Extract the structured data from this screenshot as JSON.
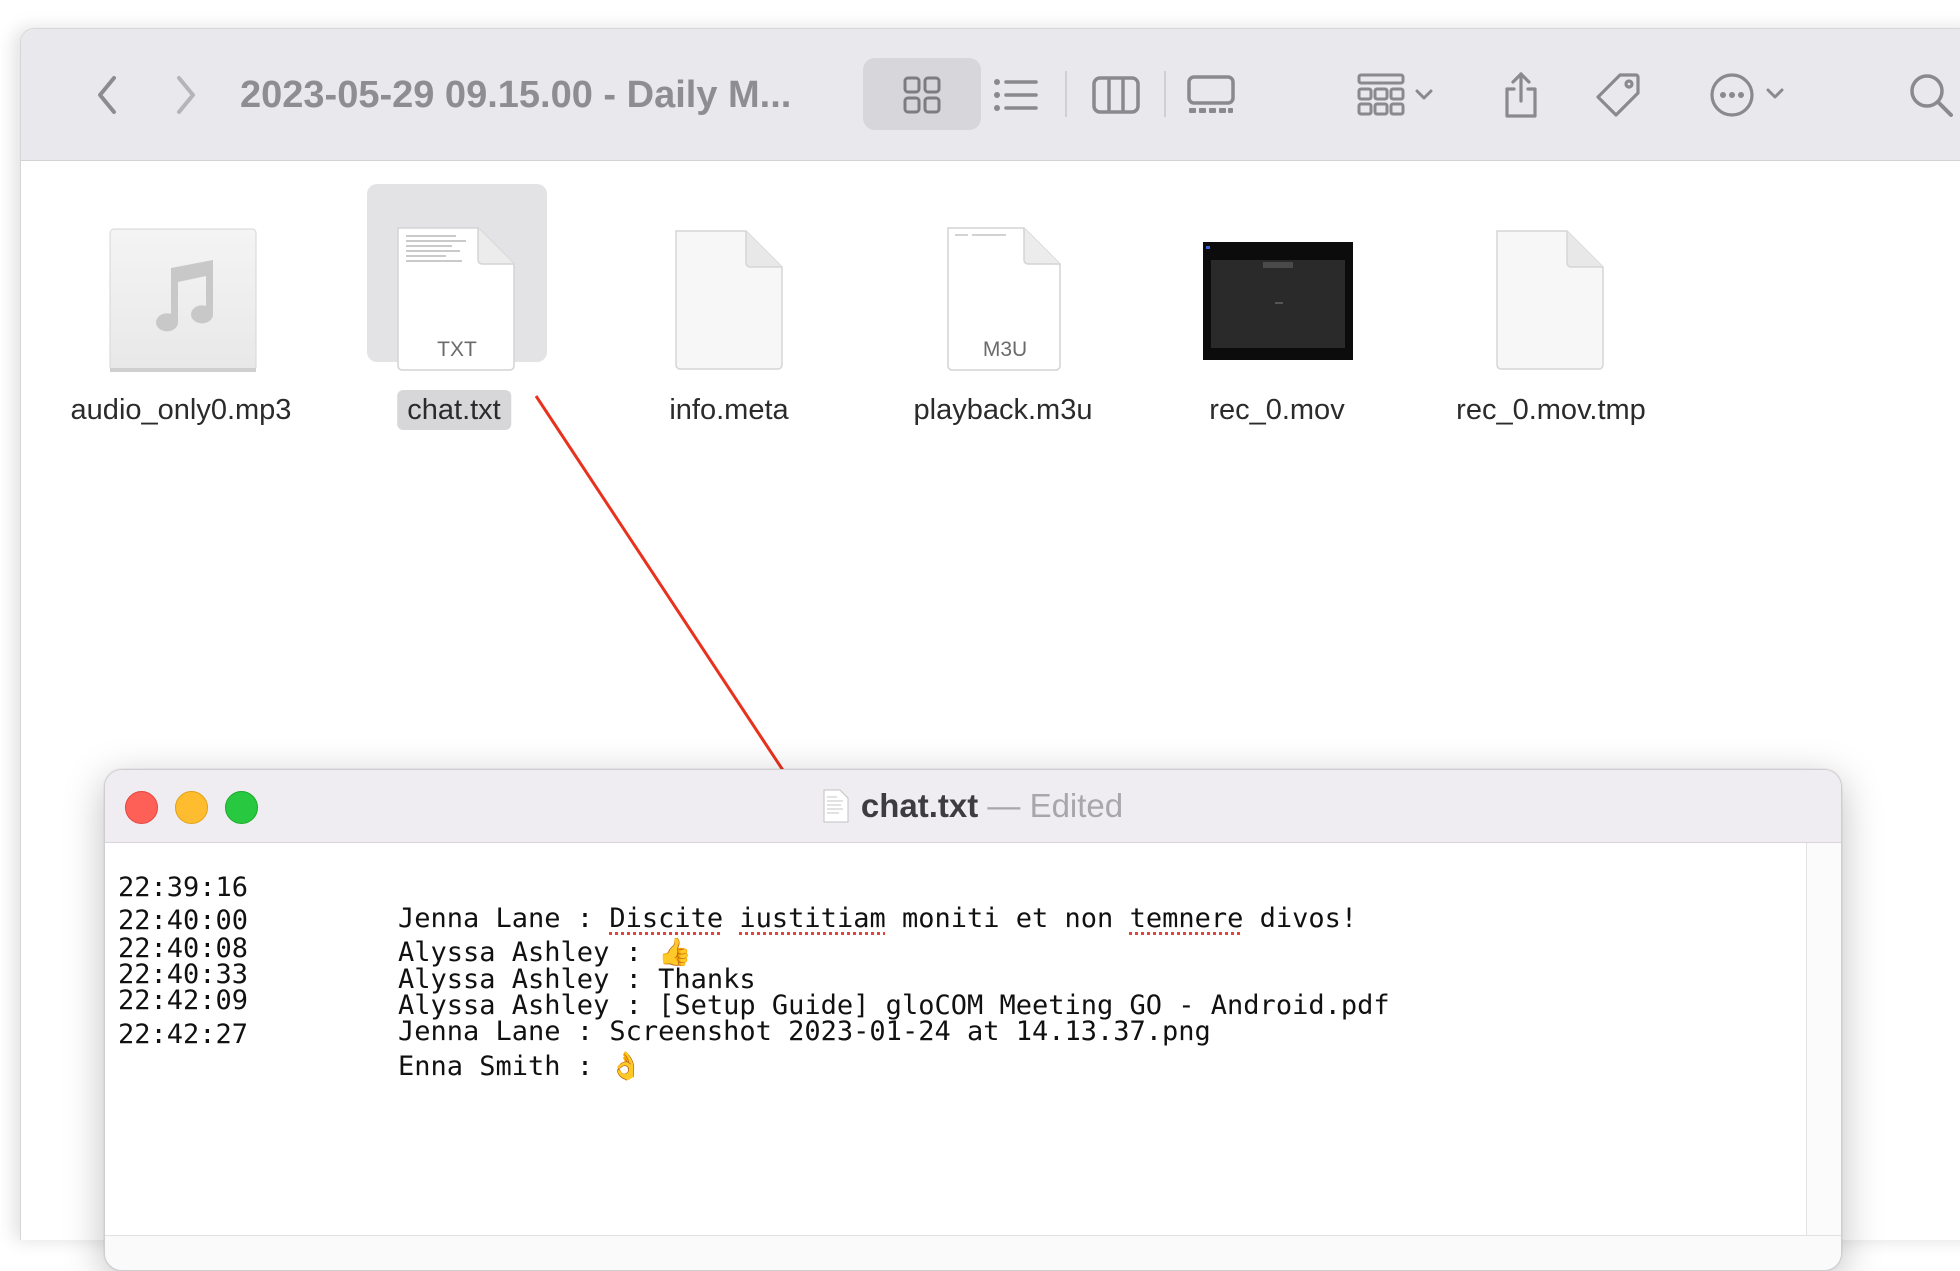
{
  "finder": {
    "title": "2023-05-29 09.15.00 - Daily M...",
    "files": [
      {
        "name": "audio_only0.mp3",
        "kind": "music"
      },
      {
        "name": "chat.txt",
        "kind": "txt",
        "badge": "TXT",
        "selected": true
      },
      {
        "name": "info.meta",
        "kind": "blank"
      },
      {
        "name": "playback.m3u",
        "kind": "m3u",
        "badge": "M3U"
      },
      {
        "name": "rec_0.mov",
        "kind": "video"
      },
      {
        "name": "rec_0.mov.tmp",
        "kind": "blank"
      }
    ]
  },
  "textedit": {
    "filename": "chat.txt",
    "separator": "—",
    "status": "Edited",
    "lines": [
      {
        "time": "22:39:16",
        "sender": "Jenna Lane",
        "message": "Discite iustitiam moniti et non temnere divos!"
      },
      {
        "time": "22:40:00",
        "sender": "Alyssa Ashley",
        "message": "👍"
      },
      {
        "time": "22:40:08",
        "sender": "Alyssa Ashley",
        "message": "Thanks"
      },
      {
        "time": "22:40:33",
        "sender": "Alyssa Ashley",
        "message": "[Setup Guide] gloCOM Meeting GO - Android.pdf"
      },
      {
        "time": "22:42:09",
        "sender": "Jenna Lane",
        "message": "Screenshot 2023-01-24 at 14.13.37.png"
      },
      {
        "time": "22:42:27",
        "sender": "Enna Smith",
        "message": "👌"
      }
    ]
  },
  "icons": [
    "back-icon",
    "forward-icon",
    "grid-view-icon",
    "list-view-icon",
    "column-view-icon",
    "gallery-view-icon",
    "group-icon",
    "share-icon",
    "tag-icon",
    "more-icon",
    "search-icon"
  ],
  "colors": {
    "close": "#fe5f57",
    "minimize": "#febc2e",
    "zoom": "#28c840",
    "annotation_arrow": "#e8321e"
  }
}
